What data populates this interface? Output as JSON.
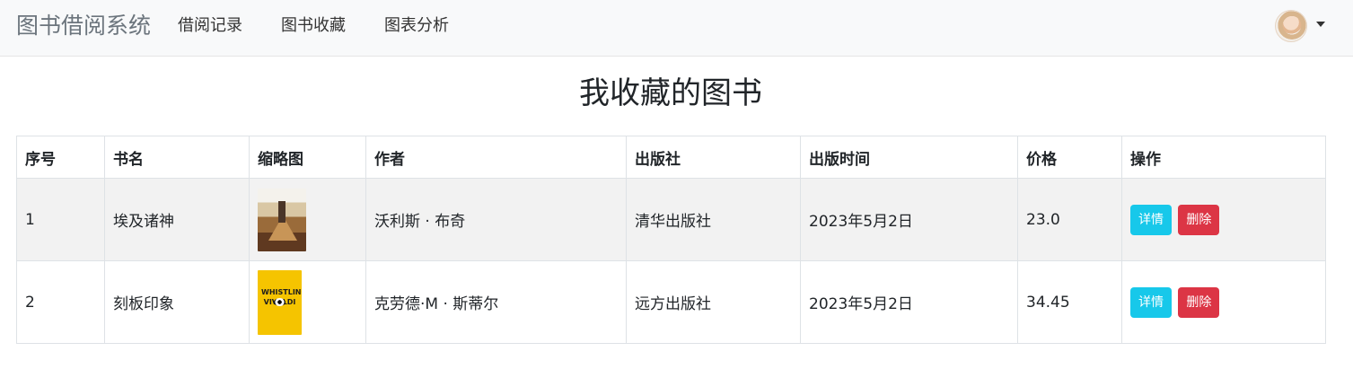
{
  "navbar": {
    "brand": "图书借阅系统",
    "items": [
      {
        "label": "借阅记录"
      },
      {
        "label": "图书收藏"
      },
      {
        "label": "图表分析"
      }
    ]
  },
  "page": {
    "title": "我收藏的图书"
  },
  "table": {
    "headers": [
      "序号",
      "书名",
      "缩略图",
      "作者",
      "出版社",
      "出版时间",
      "价格",
      "操作"
    ],
    "rows": [
      {
        "index": "1",
        "title": "埃及诸神",
        "author": "沃利斯 · 布奇",
        "publisher": "清华出版社",
        "published": "2023年5月2日",
        "price": "23.0",
        "detail_label": "详情",
        "delete_label": "删除"
      },
      {
        "index": "2",
        "title": "刻板印象",
        "author": "克劳德·M · 斯蒂尔",
        "publisher": "远方出版社",
        "published": "2023年5月2日",
        "price": "34.45",
        "detail_label": "详情",
        "delete_label": "删除"
      }
    ]
  }
}
